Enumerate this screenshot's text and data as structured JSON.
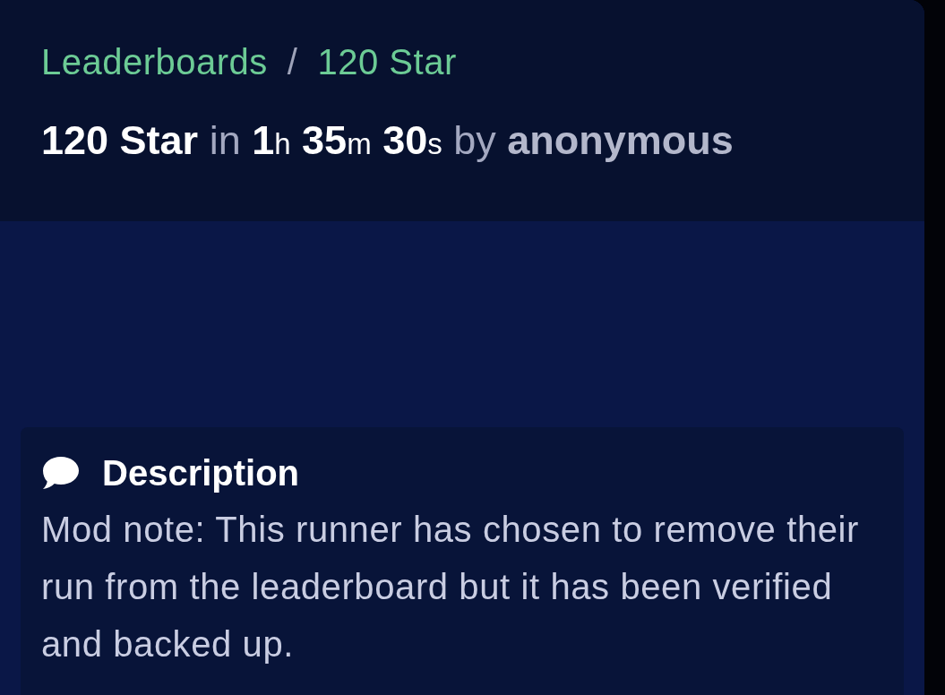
{
  "breadcrumb": {
    "items": [
      {
        "label": "Leaderboards"
      },
      {
        "label": "120 Star"
      }
    ],
    "separator": "/"
  },
  "run": {
    "category": "120 Star",
    "in": "in",
    "time": [
      {
        "value": "1",
        "unit": "h"
      },
      {
        "value": "35",
        "unit": "m"
      },
      {
        "value": "30",
        "unit": "s"
      }
    ],
    "by": "by",
    "runner": "anonymous"
  },
  "description": {
    "heading": "Description",
    "text": "Mod note: This runner has chosen to remove their run from the leaderboard but it has been verified and backed up."
  }
}
